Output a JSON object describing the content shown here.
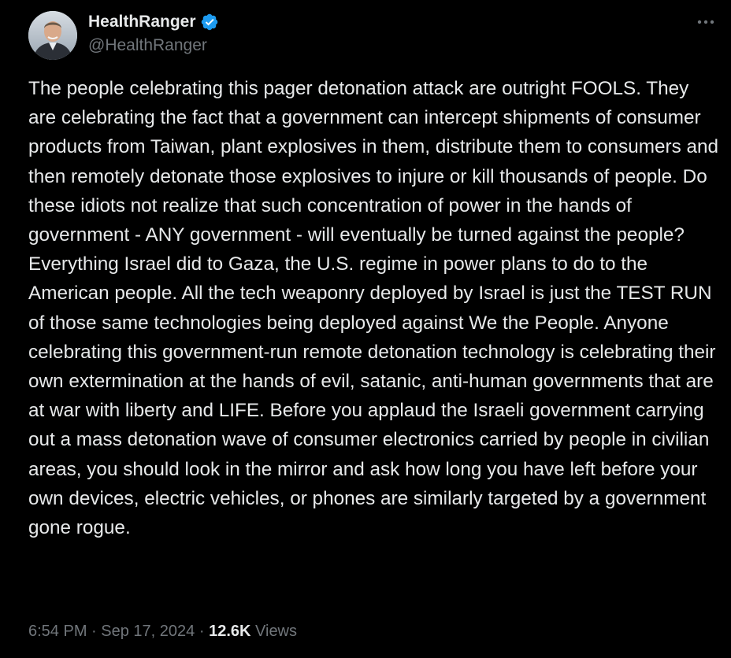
{
  "author": {
    "display_name": "HealthRanger",
    "handle": "@HealthRanger",
    "verified": true,
    "verified_color": "#1d9bf0"
  },
  "tweet": {
    "text": "The people celebrating this pager detonation attack are outright FOOLS. They are celebrating the fact that a government can intercept shipments of consumer products from Taiwan, plant explosives in them, distribute them to consumers and then remotely detonate those explosives to injure or kill thousands of people. Do these idiots not realize that such concentration of power in the hands of government - ANY government - will eventually be turned against the people? Everything Israel did to Gaza, the U.S. regime in power plans to do to the American people. All the tech weaponry deployed by Israel is just the TEST RUN of those same technologies being deployed against We the People. Anyone celebrating this government-run remote detonation technology is celebrating their own extermination at the hands of evil, satanic, anti-human governments that are at war with liberty and LIFE. Before you applaud the Israeli government carrying out a mass detonation wave of consumer electronics carried by people in civilian areas, you should look in the mirror and ask how long you have left before your own devices, electric vehicles, or phones are similarly targeted by a government gone rogue."
  },
  "meta": {
    "time": "6:54 PM",
    "separator": "·",
    "date": "Sep 17, 2024",
    "views_count": "12.6K",
    "views_label": "Views"
  },
  "icons": {
    "more": "more-horizontal-icon",
    "verified": "verified-badge-icon"
  },
  "colors": {
    "background": "#000000",
    "text_primary": "#e7e9ea",
    "text_secondary": "#71767b"
  }
}
